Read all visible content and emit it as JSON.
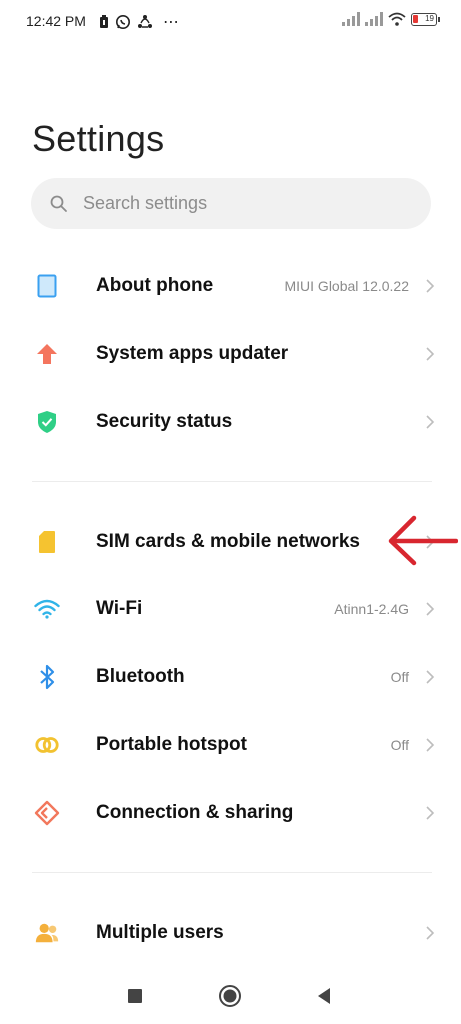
{
  "status_bar": {
    "time": "12:42 PM",
    "battery": "19",
    "colors": {
      "battery_low": "#e53935"
    }
  },
  "page": {
    "title": "Settings"
  },
  "search": {
    "placeholder": "Search settings"
  },
  "groups": [
    {
      "items": [
        {
          "id": "about-phone",
          "label": "About phone",
          "value": "MIUI Global 12.0.22",
          "icon": "phone-icon",
          "icon_color": "#3aa0f0"
        },
        {
          "id": "system-apps-updater",
          "label": "System apps updater",
          "value": "",
          "icon": "arrow-up-icon",
          "icon_color": "#f4755e"
        },
        {
          "id": "security-status",
          "label": "Security status",
          "value": "",
          "icon": "shield-check-icon",
          "icon_color": "#2fcf86"
        }
      ]
    },
    {
      "items": [
        {
          "id": "sim-cards",
          "label": "SIM cards & mobile networks",
          "value": "",
          "icon": "sim-card-icon",
          "icon_color": "#f5c330"
        },
        {
          "id": "wifi",
          "label": "Wi-Fi",
          "value": "Atinn1-2.4G",
          "icon": "wifi-icon",
          "icon_color": "#30b4e8"
        },
        {
          "id": "bluetooth",
          "label": "Bluetooth",
          "value": "Off",
          "icon": "bluetooth-icon",
          "icon_color": "#2f8fe8"
        },
        {
          "id": "portable-hotspot",
          "label": "Portable hotspot",
          "value": "Off",
          "icon": "hotspot-icon",
          "icon_color": "#f2c230"
        },
        {
          "id": "connection-sharing",
          "label": "Connection & sharing",
          "value": "",
          "icon": "connection-icon",
          "icon_color": "#f2785c"
        }
      ]
    },
    {
      "items": [
        {
          "id": "multiple-users",
          "label": "Multiple users",
          "value": "",
          "icon": "users-icon",
          "icon_color": "#f4b03c"
        }
      ]
    }
  ],
  "annotation": {
    "icon": "red-arrow-icon",
    "color": "#d8262f"
  },
  "nav": {
    "buttons": [
      "recents-icon",
      "home-icon",
      "back-icon"
    ]
  }
}
